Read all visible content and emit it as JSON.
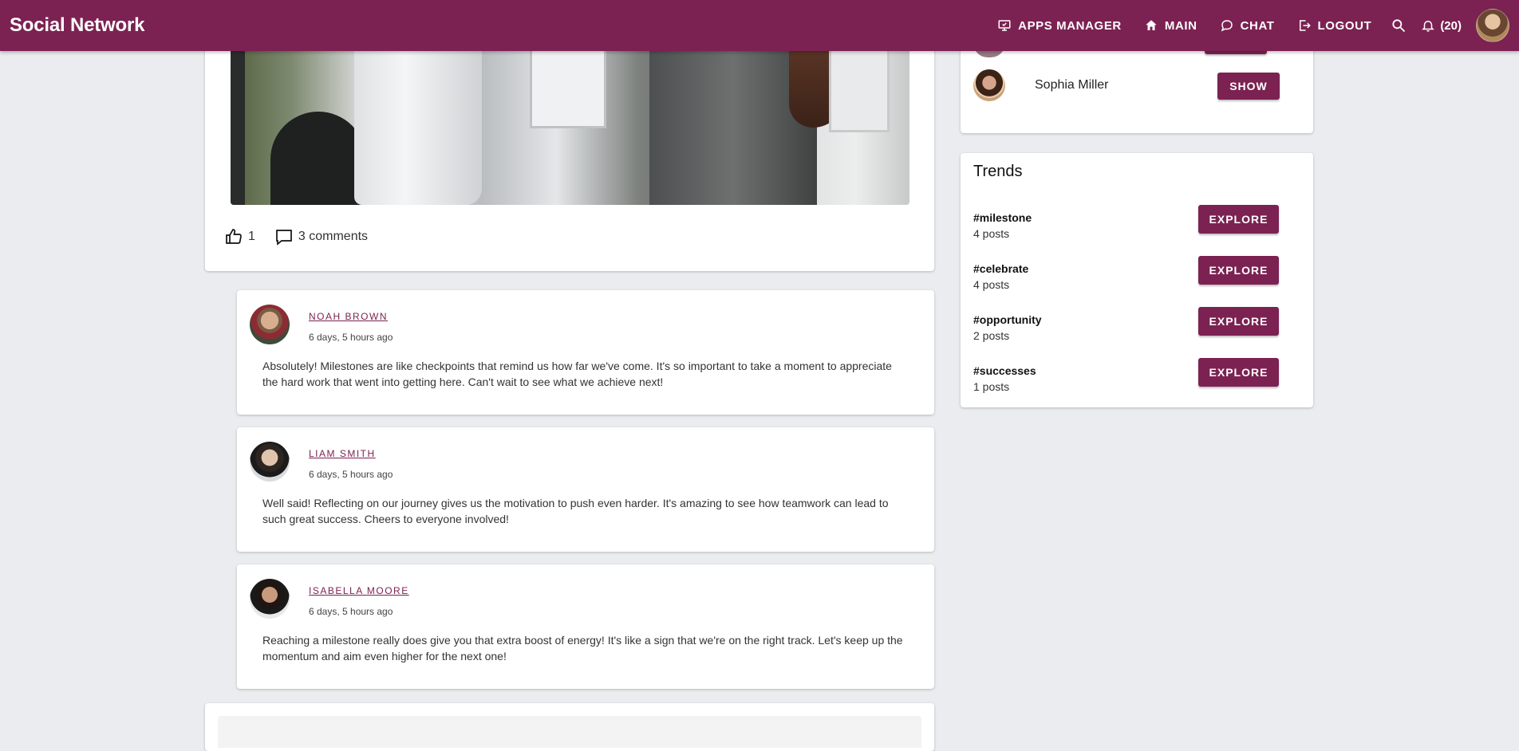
{
  "app": {
    "title": "Social Network"
  },
  "nav": {
    "apps_manager": "APPS MANAGER",
    "main": "MAIN",
    "chat": "CHAT",
    "logout": "LOGOUT",
    "notifications_count": "(20)"
  },
  "post": {
    "likes": "1",
    "comments_label": "3 comments"
  },
  "comments": [
    {
      "author": "NOAH BROWN",
      "time": "6 days, 5 hours ago",
      "text": "Absolutely! Milestones are like checkpoints that remind us how far we've come. It's so important to take a moment to appreciate the hard work that went into getting here. Can't wait to see what we achieve next!"
    },
    {
      "author": "LIAM SMITH",
      "time": "6 days, 5 hours ago",
      "text": "Well said! Reflecting on our journey gives us the motivation to push even harder. It's amazing to see how teamwork can lead to such great success. Cheers to everyone involved!"
    },
    {
      "author": "ISABELLA MOORE",
      "time": "6 days, 5 hours ago",
      "text": "Reaching a milestone really does give you that extra boost of energy! It's like a sign that we're on the right track. Let's keep up the momentum and aim even higher for the next one!"
    }
  ],
  "friends": {
    "items": [
      {
        "name": "Sophia Miller",
        "button": "SHOW"
      }
    ]
  },
  "trends": {
    "title": "Trends",
    "items": [
      {
        "tag": "#milestone",
        "count": "4 posts",
        "button": "EXPLORE"
      },
      {
        "tag": "#celebrate",
        "count": "4 posts",
        "button": "EXPLORE"
      },
      {
        "tag": "#opportunity",
        "count": "2 posts",
        "button": "EXPLORE"
      },
      {
        "tag": "#successes",
        "count": "1 posts",
        "button": "EXPLORE"
      }
    ]
  },
  "theme": {
    "primary": "#7b2252",
    "background": "#eaecef"
  }
}
